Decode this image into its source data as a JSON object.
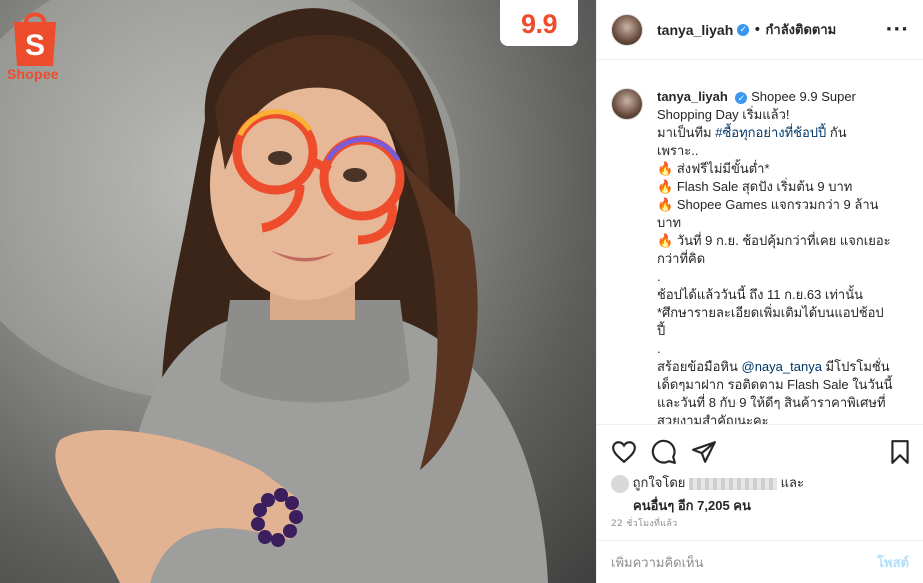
{
  "photo": {
    "brand_name": "Shopee",
    "brand_initial": "S",
    "badge": "9.9",
    "glasses_text": "9.9",
    "brand_color": "#ee4d2d"
  },
  "header": {
    "username": "tanya_liyah",
    "verified_icon": "verified-badge-icon",
    "separator": "•",
    "follow_label": "กำลังติดตาม",
    "more_icon": "more-options-icon",
    "more_symbol": "···"
  },
  "caption": {
    "username": "tanya_liyah",
    "lines": [
      "Shopee 9.9 Super",
      "Shopping Day เริ่มแล้ว!",
      "มาเป็นทีม",
      "#ซื้อทุกอย่างที่ช้อปปี้",
      "กัน",
      "เพราะ..",
      "ส่งฟรีไม่มีขั้นต่ำ*",
      "Flash Sale สุดปัง เริ่มต้น 9 บาท",
      "Shopee Games แจกรวมกว่า 9 ล้าน",
      "บาท",
      "วันที่ 9 ก.ย. ช้อปคุ้มกว่าที่เคย แจกเยอะ",
      "กว่าที่คิด",
      ".",
      "ช้อปได้แล้ววันนี้ ถึง 11 ก.ย.63 เท่านั้น",
      "*ศึกษารายละเอียดเพิ่มเติมได้บนแอปช้อป",
      "ปี้",
      ".",
      "สร้อยข้อมือหิน",
      "@naya_tanya",
      "มีโปรโมชั่น",
      "เด็ดๆมาฝาก รอติดตาม Flash Sale ในวันนี้",
      "และวันที่ 8 กับ 9 ให้ดีๆ สินค้าราคาพิเศษที่",
      "สวยงามสำคัญนะคะ"
    ],
    "fire_icon": "🔥"
  },
  "actions": {
    "like_icon": "heart-icon",
    "comment_icon": "comment-icon",
    "share_icon": "share-icon",
    "save_icon": "bookmark-icon"
  },
  "likes": {
    "prefix": "ถูกใจโดย",
    "suffix": "และ",
    "others_label": "คนอื่นๆ อีก 7,205 คน"
  },
  "timestamp": "22 ชั่วโมงที่แล้ว",
  "comment": {
    "placeholder": "เพิ่มความคิดเห็น",
    "post_label": "โพสต์"
  }
}
